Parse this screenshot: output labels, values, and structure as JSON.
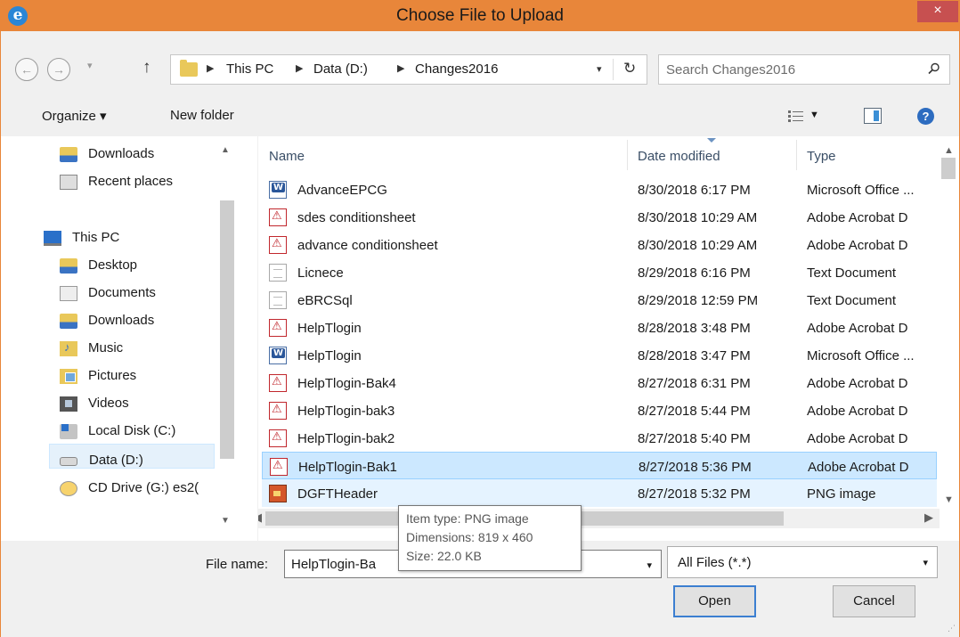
{
  "window": {
    "title": "Choose File to Upload",
    "close_label": "×",
    "app_icon": "ie-icon"
  },
  "address": {
    "crumbs": [
      "This PC",
      "Data (D:)",
      "Changes2016"
    ],
    "search_placeholder": "Search Changes2016"
  },
  "toolbar": {
    "organize": "Organize ▾",
    "new_folder": "New folder"
  },
  "nav": {
    "items": [
      {
        "label": "Downloads",
        "icon": "downloads-folder-icon"
      },
      {
        "label": "Recent places",
        "icon": "recent-places-icon"
      },
      {
        "label": "This PC",
        "icon": "this-pc-icon"
      },
      {
        "label": "Desktop",
        "icon": "desktop-folder-icon"
      },
      {
        "label": "Documents",
        "icon": "documents-folder-icon"
      },
      {
        "label": "Downloads",
        "icon": "downloads-folder-icon"
      },
      {
        "label": "Music",
        "icon": "music-folder-icon"
      },
      {
        "label": "Pictures",
        "icon": "pictures-folder-icon"
      },
      {
        "label": "Videos",
        "icon": "videos-folder-icon"
      },
      {
        "label": "Local Disk (C:)",
        "icon": "local-disk-icon"
      },
      {
        "label": "Data (D:)",
        "icon": "drive-icon"
      },
      {
        "label": "CD Drive (G:) es2(",
        "icon": "cd-drive-icon"
      }
    ]
  },
  "columns": {
    "name": "Name",
    "date": "Date modified",
    "type": "Type"
  },
  "files": [
    {
      "name": "AdvanceEPCG",
      "date": "8/30/2018 6:17 PM",
      "type": "Microsoft Office ...",
      "icon": "word-icon"
    },
    {
      "name": "sdes conditionsheet",
      "date": "8/30/2018 10:29 AM",
      "type": "Adobe Acrobat D",
      "icon": "pdf-icon"
    },
    {
      "name": "advance conditionsheet",
      "date": "8/30/2018 10:29 AM",
      "type": "Adobe Acrobat D",
      "icon": "pdf-icon"
    },
    {
      "name": "Licnece",
      "date": "8/29/2018 6:16 PM",
      "type": "Text Document",
      "icon": "text-file-icon"
    },
    {
      "name": "eBRCSql",
      "date": "8/29/2018 12:59 PM",
      "type": "Text Document",
      "icon": "text-file-icon"
    },
    {
      "name": "HelpTlogin",
      "date": "8/28/2018 3:48 PM",
      "type": "Adobe Acrobat D",
      "icon": "pdf-icon"
    },
    {
      "name": "HelpTlogin",
      "date": "8/28/2018 3:47 PM",
      "type": "Microsoft Office ...",
      "icon": "word-icon"
    },
    {
      "name": "HelpTlogin-Bak4",
      "date": "8/27/2018 6:31 PM",
      "type": "Adobe Acrobat D",
      "icon": "pdf-icon"
    },
    {
      "name": "HelpTlogin-bak3",
      "date": "8/27/2018 5:44 PM",
      "type": "Adobe Acrobat D",
      "icon": "pdf-icon"
    },
    {
      "name": "HelpTlogin-bak2",
      "date": "8/27/2018 5:40 PM",
      "type": "Adobe Acrobat D",
      "icon": "pdf-icon"
    },
    {
      "name": "HelpTlogin-Bak1",
      "date": "8/27/2018 5:36 PM",
      "type": "Adobe Acrobat D",
      "icon": "pdf-icon"
    },
    {
      "name": "DGFTHeader",
      "date": "8/27/2018 5:32 PM",
      "type": "PNG image",
      "icon": "png-icon"
    }
  ],
  "tooltip": {
    "line1": "Item type: PNG image",
    "line2": "Dimensions: 819 x 460",
    "line3": "Size: 22.0 KB"
  },
  "bottom": {
    "file_name_label": "File name:",
    "file_name_value": "HelpTlogin-Ba",
    "file_type": "All Files (*.*)",
    "open": "Open",
    "cancel": "Cancel"
  },
  "colors": {
    "titlebar": "#e8863a",
    "close": "#c75050",
    "selection": "#cce8ff",
    "accent": "#3c7fd1"
  }
}
